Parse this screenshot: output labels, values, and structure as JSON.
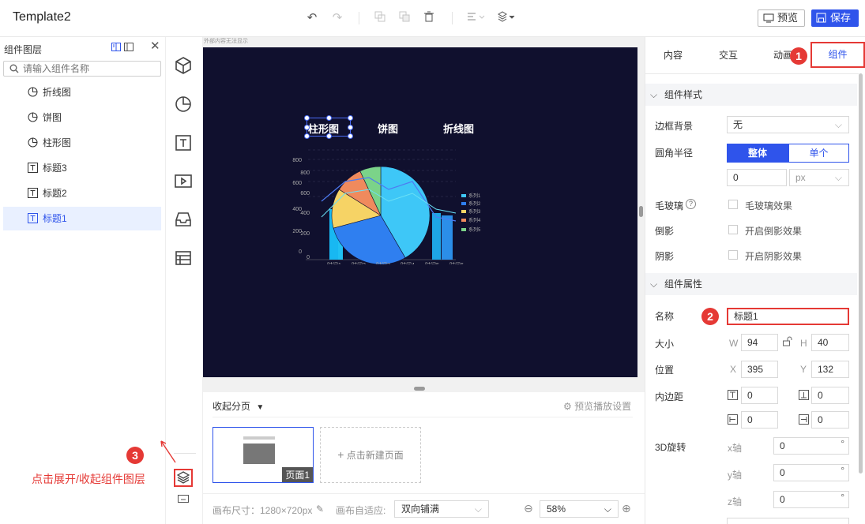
{
  "app": {
    "title": "Template2"
  },
  "toolbar": {
    "preview_label": "预览",
    "save_label": "保存"
  },
  "layers": {
    "title": "组件图层",
    "search_placeholder": "请输入组件名称",
    "items": [
      {
        "label": "折线图",
        "icon": "pie-chart-icon"
      },
      {
        "label": "饼图",
        "icon": "pie-chart-icon"
      },
      {
        "label": "柱形图",
        "icon": "pie-chart-icon"
      },
      {
        "label": "标题3",
        "icon": "text-icon"
      },
      {
        "label": "标题2",
        "icon": "text-icon"
      },
      {
        "label": "标题1",
        "icon": "text-icon",
        "active": true
      }
    ]
  },
  "canvas": {
    "tip": "外部内容无法显示",
    "tabs": [
      "柱形图",
      "饼图",
      "折线图"
    ]
  },
  "chart_data": {
    "type": "bar",
    "categories": [
      "时间1",
      "时间2",
      "时间3",
      "时间4",
      "时间5",
      "时间6"
    ],
    "yticks": [
      "800",
      "800",
      "600",
      "600",
      "400",
      "400",
      "200",
      "200",
      "0",
      "0"
    ],
    "legend": [
      "系列1",
      "系列2",
      "系列3",
      "系列4",
      "系列5"
    ],
    "pie_colors": [
      "#3ec7f7",
      "#2f7ff0",
      "#f6d365",
      "#f08a5d",
      "#7bd389"
    ]
  },
  "pages": {
    "collapse_label": "收起分页",
    "playback_label": "预览播放设置",
    "thumb_label": "页面1",
    "new_page_label": "点击新建页面"
  },
  "status": {
    "canvas_size_label": "画布尺寸：1280×720px",
    "fit_label": "画布自适应:",
    "fit_value": "双向铺满",
    "zoom_value": "58%"
  },
  "props": {
    "tabs": [
      "内容",
      "交互",
      "动画",
      "组件"
    ],
    "section_style": "组件样式",
    "border_bg_label": "边框背景",
    "border_bg_value": "无",
    "radius_label": "圆角半径",
    "radius_whole": "整体",
    "radius_single": "单个",
    "radius_value": "0",
    "radius_unit": "px",
    "glass_label": "毛玻璃",
    "glass_check": "毛玻璃效果",
    "reflect_label": "倒影",
    "reflect_check": "开启倒影效果",
    "shadow_label": "阴影",
    "shadow_check": "开启阴影效果",
    "section_attr": "组件属性",
    "name_label": "名称",
    "name_value": "标题1",
    "size_label": "大小",
    "w_prefix": "W",
    "w_value": "94",
    "h_prefix": "H",
    "h_value": "40",
    "pos_label": "位置",
    "x_prefix": "X",
    "x_value": "395",
    "y_prefix": "Y",
    "y_value": "132",
    "padding_label": "内边距",
    "pad_top": "0",
    "pad_bottom": "0",
    "pad_left": "0",
    "pad_right": "0",
    "rot_label": "3D旋转",
    "rot_x_prefix": "x轴",
    "rot_x": "0",
    "rot_y_prefix": "y轴",
    "rot_y": "0",
    "rot_z_prefix": "z轴",
    "rot_z": "0",
    "degree": "°"
  },
  "callouts": {
    "badge1": "1",
    "badge2": "2",
    "badge3": "3",
    "hint": "点击展开/收起组件图层"
  },
  "colors": {
    "accent": "#2f54eb",
    "callout": "#e53935",
    "canvas_bg": "#10102e"
  }
}
